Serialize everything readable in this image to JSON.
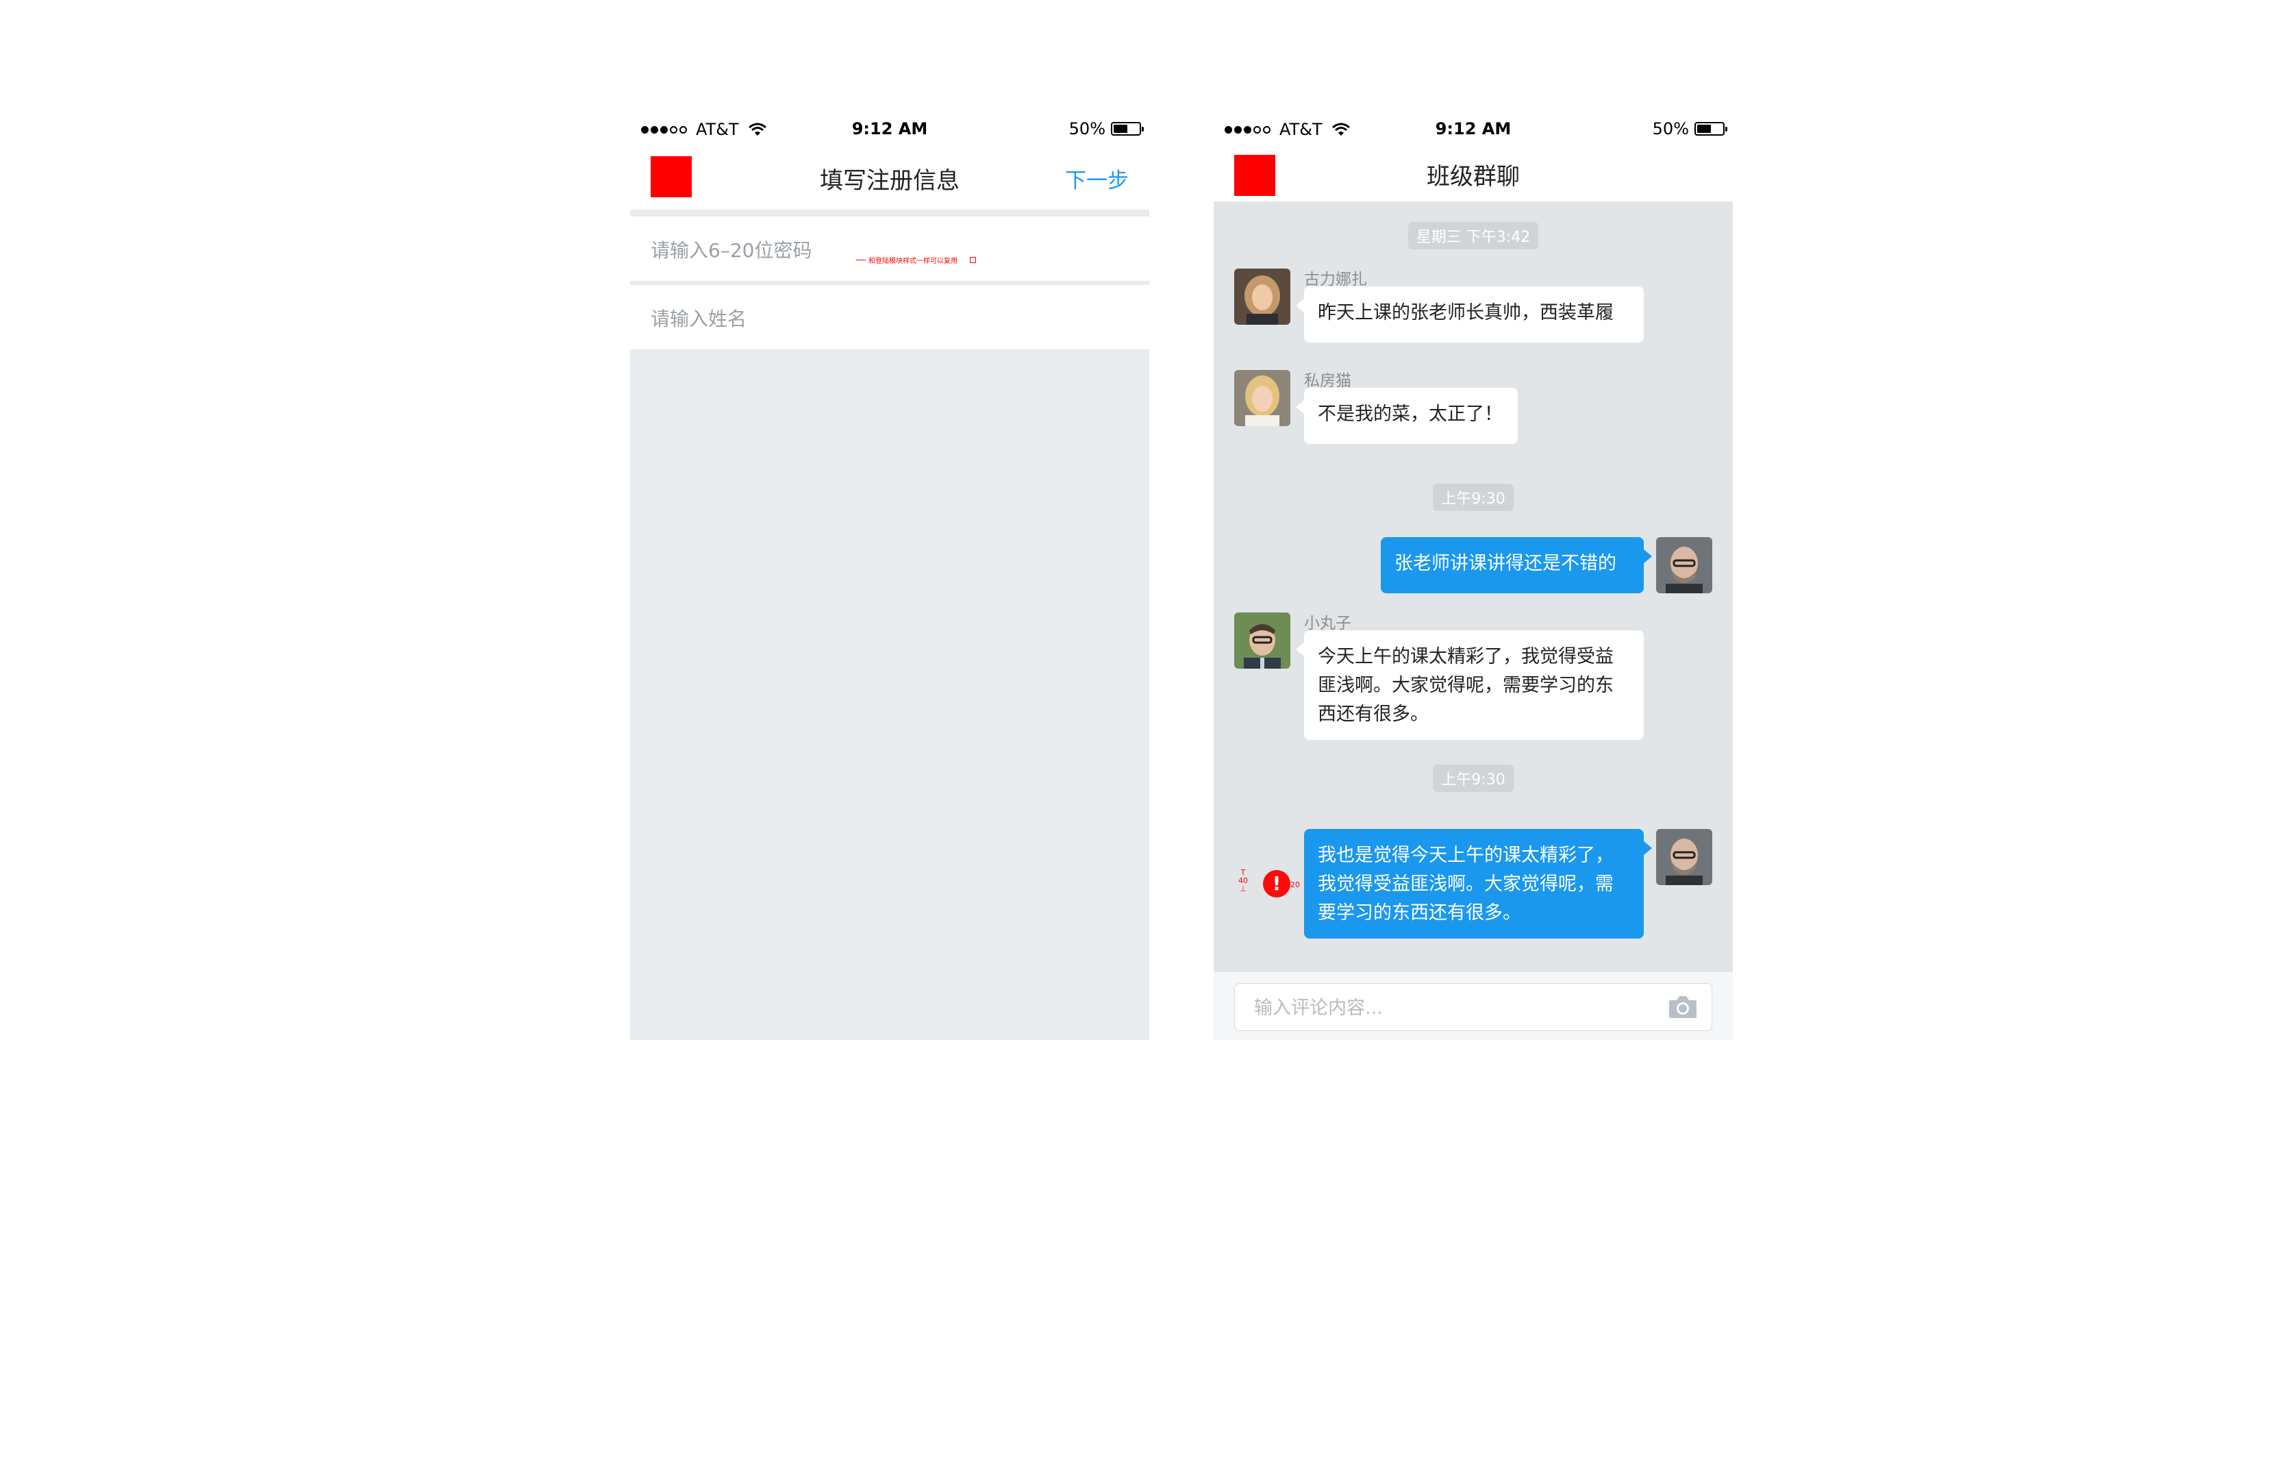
{
  "status_bar": {
    "carrier": "AT&T",
    "time": "9:12 AM",
    "battery": "50%",
    "battery_level": 0.5,
    "signal_bars": 3
  },
  "register_screen": {
    "title": "填写注册信息",
    "next_label": "下一步",
    "password_placeholder": "请输入6–20位密码",
    "name_placeholder": "请输入姓名",
    "annotation": "和登陆模块样式一样可以复用"
  },
  "chat_screen": {
    "title": "班级群聊",
    "input_placeholder": "输入评论内容...",
    "timestamps": [
      "星期三 下午3:42",
      "上午9:30",
      "上午9:30"
    ],
    "messages": [
      {
        "sender": "古力娜扎",
        "text": "昨天上课的张老师长真帅，西装革履",
        "direction": "in"
      },
      {
        "sender": "私房猫",
        "text": "不是我的菜，太正了！",
        "direction": "in"
      },
      {
        "sender": "",
        "text": "张老师讲课讲得还是不错的",
        "direction": "out"
      },
      {
        "sender": "小丸子",
        "text": "今天上午的课太精彩了，我觉得受益匪浅啊。大家觉得呢，需要学习的东西还有很多。",
        "direction": "in"
      },
      {
        "sender": "",
        "text": "我也是觉得今天上午的课太精彩了，我觉得受益匪浅啊。大家觉得呢，需要学习的东西还有很多。",
        "direction": "out",
        "failed": true
      }
    ],
    "error_mark": "!",
    "spec_marks": {
      "height": "40",
      "gap": "20"
    }
  },
  "colors": {
    "accent": "#1a98ee",
    "back_square": "#ff0000",
    "chat_background": "#e2e5e8",
    "form_background": "#e8ecef",
    "error": "#ff0a0a"
  }
}
